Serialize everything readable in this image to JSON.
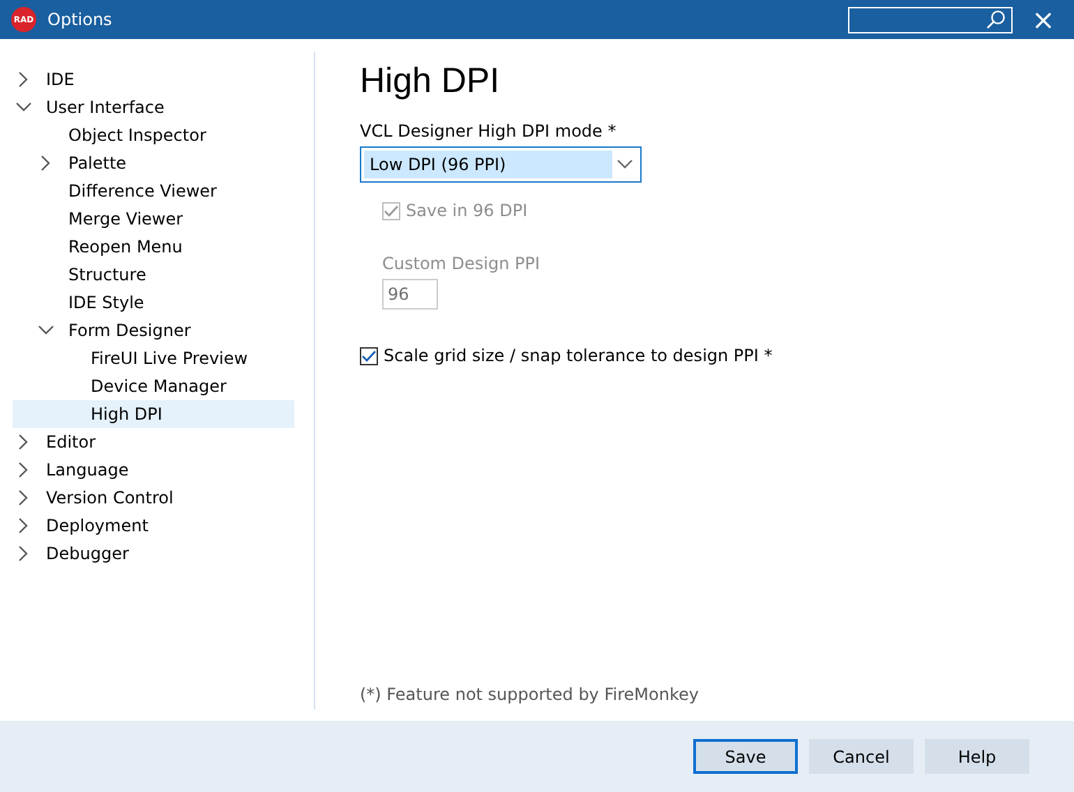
{
  "window": {
    "logo": "RAD",
    "title": "Options",
    "close": "×"
  },
  "tree": [
    {
      "label": "IDE",
      "expanded": false,
      "has_children": true,
      "selected": false
    },
    {
      "label": "User Interface",
      "expanded": true,
      "has_children": true,
      "selected": false,
      "children": [
        {
          "label": "Object Inspector",
          "has_children": false,
          "selected": false
        },
        {
          "label": "Palette",
          "expanded": false,
          "has_children": true,
          "selected": false
        },
        {
          "label": "Difference Viewer",
          "has_children": false,
          "selected": false
        },
        {
          "label": "Merge Viewer",
          "has_children": false,
          "selected": false
        },
        {
          "label": "Reopen Menu",
          "has_children": false,
          "selected": false
        },
        {
          "label": "Structure",
          "has_children": false,
          "selected": false
        },
        {
          "label": "IDE Style",
          "has_children": false,
          "selected": false
        },
        {
          "label": "Form Designer",
          "expanded": true,
          "has_children": true,
          "selected": false,
          "children": [
            {
              "label": "FireUI Live Preview",
              "has_children": false,
              "selected": false
            },
            {
              "label": "Device Manager",
              "has_children": false,
              "selected": false
            },
            {
              "label": "High DPI",
              "has_children": false,
              "selected": true
            }
          ]
        }
      ]
    },
    {
      "label": "Editor",
      "expanded": false,
      "has_children": true,
      "selected": false
    },
    {
      "label": "Language",
      "expanded": false,
      "has_children": true,
      "selected": false
    },
    {
      "label": "Version Control",
      "expanded": false,
      "has_children": true,
      "selected": false
    },
    {
      "label": "Deployment",
      "expanded": false,
      "has_children": true,
      "selected": false
    },
    {
      "label": "Debugger",
      "expanded": false,
      "has_children": true,
      "selected": false
    }
  ],
  "page": {
    "heading": "High DPI",
    "mode": {
      "label": "VCL Designer High DPI mode *",
      "value": "Low DPI (96 PPI)"
    },
    "save_96": {
      "label": "Save in 96 DPI",
      "checked": true,
      "disabled": true
    },
    "custom_ppi": {
      "label": "Custom Design PPI",
      "value": "96",
      "disabled": true
    },
    "scale_grid": {
      "label": "Scale grid size / snap tolerance to design PPI *",
      "checked": true,
      "disabled": false
    },
    "footnote": "(*) Feature not supported by FireMonkey"
  },
  "buttons": [
    {
      "label": "Save",
      "default": true
    },
    {
      "label": "Cancel",
      "default": false
    },
    {
      "label": "Help",
      "default": false
    }
  ]
}
